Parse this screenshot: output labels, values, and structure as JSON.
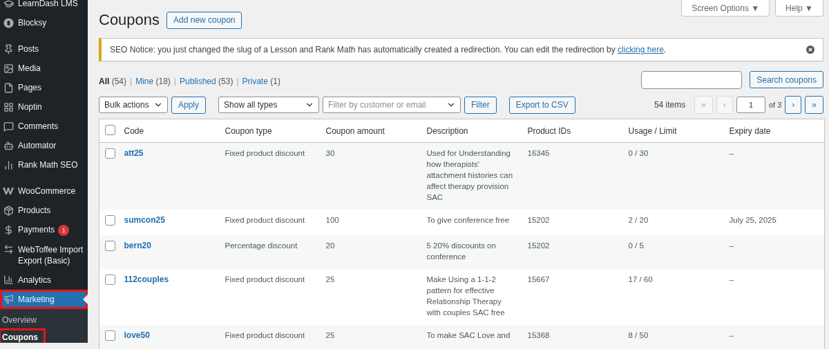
{
  "sidebar": {
    "groups": [
      [
        {
          "label": "LearnDash LMS",
          "selected": false
        },
        {
          "label": "Blocksy",
          "selected": false
        }
      ],
      [
        {
          "label": "Posts",
          "selected": false
        },
        {
          "label": "Media",
          "selected": false
        },
        {
          "label": "Pages",
          "selected": false
        },
        {
          "label": "Noptin",
          "selected": false
        },
        {
          "label": "Comments",
          "selected": false
        },
        {
          "label": "Automator",
          "selected": false
        },
        {
          "label": "Rank Math SEO",
          "selected": false
        }
      ],
      [
        {
          "label": "WooCommerce",
          "selected": false
        },
        {
          "label": "Products",
          "selected": false
        },
        {
          "label": "Payments",
          "selected": false,
          "badge": "1"
        },
        {
          "label": "WebToffee Import Export (Basic)",
          "selected": false
        },
        {
          "label": "Analytics",
          "selected": false
        },
        {
          "label": "Marketing",
          "selected": true,
          "highlighted": true,
          "submenu": [
            {
              "label": "Overview",
              "selected": false,
              "highlighted": false
            },
            {
              "label": "Coupons",
              "selected": true,
              "highlighted": true
            }
          ]
        }
      ]
    ]
  },
  "header": {
    "title": "Coupons",
    "add_button": "Add new coupon",
    "screen_options": "Screen Options ▼",
    "help": "Help ▼"
  },
  "notice": {
    "text": "SEO Notice: you just changed the slug of a Lesson and Rank Math has automatically created a redirection. You can edit the redirection by ",
    "link": "clicking here",
    "after": "."
  },
  "views": [
    {
      "label": "All",
      "count": "(54)",
      "selected": true
    },
    {
      "separator": "|",
      "label": "Mine",
      "count": "(18)",
      "selected": false
    },
    {
      "separator": "|",
      "label": "Published",
      "count": "(53)",
      "selected": false
    },
    {
      "separator": "|",
      "label": "Private",
      "count": "(1)",
      "selected": false
    }
  ],
  "search": {
    "button": "Search coupons"
  },
  "tablenav": {
    "bulk_actions": "Bulk actions",
    "apply": "Apply",
    "type_filter": "Show all types",
    "customer_filter": {
      "placeholder": "Filter by customer or email"
    },
    "filter": "Filter",
    "export": "Export to CSV",
    "pagination": {
      "items": "54 items",
      "first": {
        "label": "«",
        "disabled": true
      },
      "prev": {
        "label": "‹",
        "disabled": true
      },
      "page": "1",
      "of": "of 3",
      "next": {
        "label": "›",
        "disabled": false
      },
      "last": {
        "label": "»",
        "disabled": false
      }
    }
  },
  "table": {
    "all_checked": false,
    "columns": [
      "Code",
      "Coupon type",
      "Coupon amount",
      "Description",
      "Product IDs",
      "Usage / Limit",
      "Expiry date"
    ],
    "rows": [
      {
        "checked": false,
        "cells": [
          "att25",
          "Fixed product discount",
          "30",
          "Used for Understanding how therapists' attachment histories can affect therapy provision SAC",
          "16345",
          "0 / 30",
          "–"
        ]
      },
      {
        "checked": false,
        "cells": [
          "sumcon25",
          "Fixed product discount",
          "100",
          "To give conference free",
          "15202",
          "2 / 20",
          "July 25, 2025"
        ]
      },
      {
        "checked": false,
        "cells": [
          "bern20",
          "Percentage discount",
          "20",
          "5 20% discounts on conference",
          "15202",
          "0 / 5",
          "–"
        ]
      },
      {
        "checked": false,
        "cells": [
          "112couples",
          "Fixed product discount",
          "25",
          "Make Using a 1-1-2 pattern for effective Relationship Therapy with couples SAC free",
          "15667",
          "17 / 60",
          "–"
        ]
      },
      {
        "checked": false,
        "cells": [
          "love50",
          "Fixed product discount",
          "25",
          "To make SAC Love and",
          "15368",
          "8 / 50",
          "–"
        ]
      }
    ]
  }
}
